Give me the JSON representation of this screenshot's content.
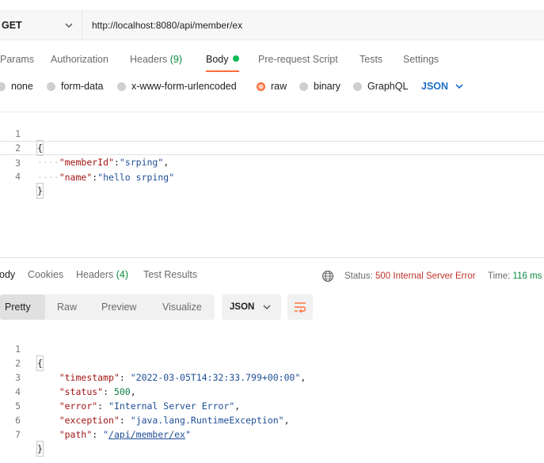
{
  "request": {
    "method": "GET",
    "url": "http://localhost:8080/api/member/ex"
  },
  "request_tabs": [
    {
      "label": "Params"
    },
    {
      "label": "Authorization"
    },
    {
      "label": "Headers",
      "count": "(9)"
    },
    {
      "label": "Body"
    },
    {
      "label": "Pre-request Script"
    },
    {
      "label": "Tests"
    },
    {
      "label": "Settings"
    }
  ],
  "body_options": {
    "none": "none",
    "form_data": "form-data",
    "urlencoded": "x-www-form-urlencoded",
    "raw": "raw",
    "binary": "binary",
    "graphql": "GraphQL",
    "format": "JSON",
    "selected": "raw"
  },
  "request_body": {
    "line_numbers": [
      "1",
      "2",
      "3",
      "4"
    ],
    "open_brace": "{",
    "close_brace": "}",
    "key1": "\"memberId\"",
    "val1": "\"srping\"",
    "key2": "\"name\"",
    "val2": "\"hello srping\""
  },
  "response_tabs": {
    "body": "ody",
    "cookies": "Cookies",
    "headers": "Headers",
    "headers_count": "(4)",
    "test_results": "Test Results"
  },
  "response_status": {
    "status_label": "Status:",
    "status_value": "500 Internal Server Error",
    "time_label": "Time:",
    "time_value": "116 ms"
  },
  "view_modes": {
    "pretty": "Pretty",
    "raw": "Raw",
    "preview": "Preview",
    "visualize": "Visualize",
    "format": "JSON"
  },
  "response_body": {
    "line_numbers": [
      "1",
      "2",
      "3",
      "4",
      "5",
      "6",
      "7"
    ],
    "open_brace": "{",
    "close_brace": "}",
    "k_timestamp": "\"timestamp\"",
    "v_timestamp": "\"2022-03-05T14:32:33.799+00:00\"",
    "k_status": "\"status\"",
    "v_status": "500",
    "k_error": "\"error\"",
    "v_error": "\"Internal Server Error\"",
    "k_exception": "\"exception\"",
    "v_exception": "\"java.lang.RuntimeException\"",
    "k_path": "\"path\"",
    "v_path_q1": "\"",
    "v_path": "/api/member/ex",
    "v_path_q2": "\""
  },
  "colors": {
    "accent": "#ff6c37",
    "link": "#1d6fcb",
    "success": "#0b8a3e",
    "error": "#c0342b"
  }
}
